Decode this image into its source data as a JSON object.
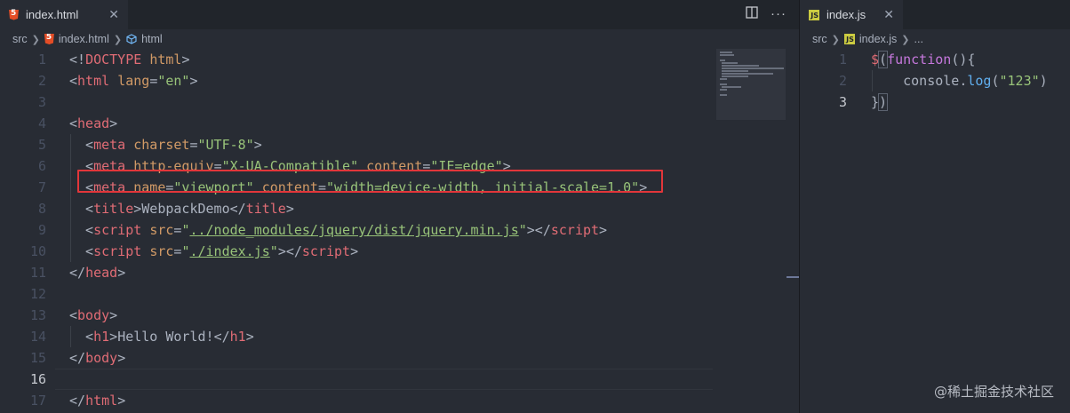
{
  "left_editor": {
    "tab": {
      "label": "index.html",
      "file_icon": "html5-icon",
      "close_icon": "close-icon"
    },
    "tab_actions": [
      "split-editor-icon",
      "more-actions-icon"
    ],
    "breadcrumb": [
      {
        "label": "src"
      },
      {
        "label": "index.html",
        "icon": "html5-icon"
      },
      {
        "label": "html",
        "icon": "element-cube-icon"
      }
    ],
    "active_line": 16,
    "lines": [
      {
        "n": "1",
        "tokens": [
          [
            "punc",
            "<!"
          ],
          [
            "tag",
            "DOCTYPE"
          ],
          [
            "punc",
            " "
          ],
          [
            "attr",
            "html"
          ],
          [
            "punc",
            ">"
          ]
        ]
      },
      {
        "n": "2",
        "tokens": [
          [
            "punc",
            "<"
          ],
          [
            "tag",
            "html"
          ],
          [
            "punc",
            " "
          ],
          [
            "attr",
            "lang"
          ],
          [
            "punc",
            "="
          ],
          [
            "str",
            "\"en\""
          ],
          [
            "punc",
            ">"
          ]
        ]
      },
      {
        "n": "3",
        "tokens": []
      },
      {
        "n": "4",
        "tokens": [
          [
            "punc",
            "<"
          ],
          [
            "tag",
            "head"
          ],
          [
            "punc",
            ">"
          ]
        ]
      },
      {
        "n": "5",
        "tokens": [
          [
            "punc",
            "  <"
          ],
          [
            "tag",
            "meta"
          ],
          [
            "punc",
            " "
          ],
          [
            "attr",
            "charset"
          ],
          [
            "punc",
            "="
          ],
          [
            "str",
            "\"UTF-8\""
          ],
          [
            "punc",
            ">"
          ]
        ]
      },
      {
        "n": "6",
        "tokens": [
          [
            "punc",
            "  <"
          ],
          [
            "tag",
            "meta"
          ],
          [
            "punc",
            " "
          ],
          [
            "attr",
            "http-equiv"
          ],
          [
            "punc",
            "="
          ],
          [
            "str",
            "\"X-UA-Compatible\""
          ],
          [
            "punc",
            " "
          ],
          [
            "attr",
            "content"
          ],
          [
            "punc",
            "="
          ],
          [
            "str",
            "\"IE=edge\""
          ],
          [
            "punc",
            ">"
          ]
        ]
      },
      {
        "n": "7",
        "tokens": [
          [
            "punc",
            "  <"
          ],
          [
            "tag",
            "meta"
          ],
          [
            "punc",
            " "
          ],
          [
            "attr",
            "name"
          ],
          [
            "punc",
            "="
          ],
          [
            "str",
            "\"viewport\""
          ],
          [
            "punc",
            " "
          ],
          [
            "attr",
            "content"
          ],
          [
            "punc",
            "="
          ],
          [
            "str",
            "\"width=device-width, initial-scale=1.0\""
          ],
          [
            "punc",
            ">"
          ]
        ]
      },
      {
        "n": "8",
        "tokens": [
          [
            "punc",
            "  <"
          ],
          [
            "tag",
            "title"
          ],
          [
            "punc",
            ">"
          ],
          [
            "text",
            "WebpackDemo"
          ],
          [
            "punc",
            "</"
          ],
          [
            "tag",
            "title"
          ],
          [
            "punc",
            ">"
          ]
        ]
      },
      {
        "n": "9",
        "tokens": [
          [
            "punc",
            "  <"
          ],
          [
            "tag",
            "script"
          ],
          [
            "punc",
            " "
          ],
          [
            "attr",
            "src"
          ],
          [
            "punc",
            "="
          ],
          [
            "str",
            "\""
          ],
          [
            "strlink",
            "../node_modules/jquery/dist/jquery.min.js"
          ],
          [
            "str",
            "\""
          ],
          [
            "punc",
            "></"
          ],
          [
            "tag",
            "script"
          ],
          [
            "punc",
            ">"
          ]
        ]
      },
      {
        "n": "10",
        "tokens": [
          [
            "punc",
            "  <"
          ],
          [
            "tag",
            "script"
          ],
          [
            "punc",
            " "
          ],
          [
            "attr",
            "src"
          ],
          [
            "punc",
            "="
          ],
          [
            "str",
            "\""
          ],
          [
            "strlink",
            "./index.js"
          ],
          [
            "str",
            "\""
          ],
          [
            "punc",
            "></"
          ],
          [
            "tag",
            "script"
          ],
          [
            "punc",
            ">"
          ]
        ]
      },
      {
        "n": "11",
        "tokens": [
          [
            "punc",
            "</"
          ],
          [
            "tag",
            "head"
          ],
          [
            "punc",
            ">"
          ]
        ]
      },
      {
        "n": "12",
        "tokens": []
      },
      {
        "n": "13",
        "tokens": [
          [
            "punc",
            "<"
          ],
          [
            "tag",
            "body"
          ],
          [
            "punc",
            ">"
          ]
        ]
      },
      {
        "n": "14",
        "tokens": [
          [
            "punc",
            "  <"
          ],
          [
            "tag",
            "h1"
          ],
          [
            "punc",
            ">"
          ],
          [
            "text",
            "Hello World!"
          ],
          [
            "punc",
            "</"
          ],
          [
            "tag",
            "h1"
          ],
          [
            "punc",
            ">"
          ]
        ]
      },
      {
        "n": "15",
        "tokens": [
          [
            "punc",
            "</"
          ],
          [
            "tag",
            "body"
          ],
          [
            "punc",
            ">"
          ]
        ]
      },
      {
        "n": "16",
        "tokens": []
      },
      {
        "n": "17",
        "tokens": [
          [
            "punc",
            "</"
          ],
          [
            "tag",
            "html"
          ],
          [
            "punc",
            ">"
          ]
        ]
      }
    ],
    "highlighted_line": 9
  },
  "right_editor": {
    "tab": {
      "label": "index.js",
      "file_icon": "js-icon",
      "close_icon": "close-icon"
    },
    "breadcrumb": [
      {
        "label": "src"
      },
      {
        "label": "index.js",
        "icon": "js-icon"
      },
      {
        "label": "..."
      }
    ],
    "lines": [
      {
        "n": "1",
        "tokens": [
          [
            "var",
            "$"
          ],
          [
            "bracket",
            "("
          ],
          [
            "kw",
            "function"
          ],
          [
            "punc",
            "(){"
          ]
        ]
      },
      {
        "n": "2",
        "tokens": [
          [
            "punc",
            "    console."
          ],
          [
            "fn",
            "log"
          ],
          [
            "punc",
            "("
          ],
          [
            "str",
            "\"123\""
          ],
          [
            "punc",
            ")"
          ]
        ]
      },
      {
        "n": "3",
        "tokens": [
          [
            "punc",
            "}"
          ],
          [
            "bracket",
            ")"
          ]
        ]
      }
    ]
  },
  "watermark": "@稀土掘金技术社区",
  "colors": {
    "background": "#282c34",
    "tag": "#e06c75",
    "attribute": "#d19a66",
    "string": "#98c379",
    "highlight_box": "#e2363a"
  }
}
